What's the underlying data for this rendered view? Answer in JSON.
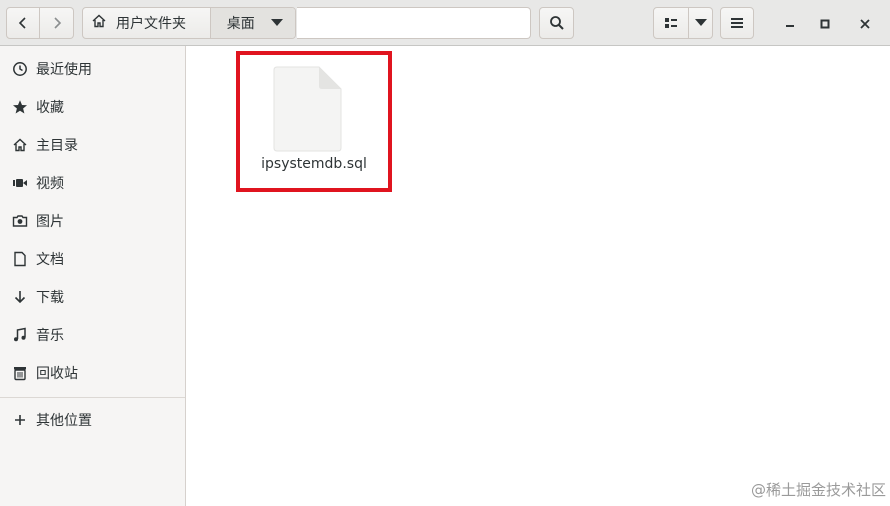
{
  "header": {
    "back_icon": "back-arrow-icon",
    "forward_icon": "forward-arrow-icon",
    "breadcrumbs": [
      {
        "label": "用户文件夹",
        "icon": "home-icon"
      },
      {
        "label": "桌面"
      }
    ],
    "location_input_value": ""
  },
  "sidebar": {
    "items": [
      {
        "label": "最近使用",
        "icon": "recent-icon"
      },
      {
        "label": "收藏",
        "icon": "star-icon"
      },
      {
        "label": "主目录",
        "icon": "home-icon"
      },
      {
        "label": "视频",
        "icon": "video-icon"
      },
      {
        "label": "图片",
        "icon": "camera-icon"
      },
      {
        "label": "文档",
        "icon": "document-icon"
      },
      {
        "label": "下载",
        "icon": "download-icon"
      },
      {
        "label": "音乐",
        "icon": "music-icon"
      },
      {
        "label": "回收站",
        "icon": "trash-icon"
      }
    ],
    "other": {
      "label": "其他位置",
      "icon": "plus-icon"
    }
  },
  "files": [
    {
      "name": "ipsystemdb.sql",
      "type": "sql-file",
      "highlighted": true
    }
  ],
  "colors": {
    "highlight": "#e0141f",
    "sidebar_bg": "#f6f5f4",
    "header_bg": "#e8e8e7"
  },
  "watermark": "@稀土掘金技术社区"
}
